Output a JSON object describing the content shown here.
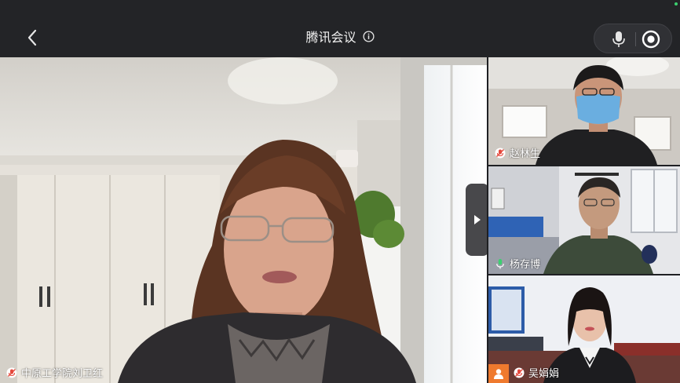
{
  "header": {
    "title": "腾讯会议"
  },
  "participants": {
    "main": {
      "name": "中原工学院刘卫红"
    },
    "tiles": [
      {
        "name": "赵林生"
      },
      {
        "name": "杨存博"
      },
      {
        "name": "吴娟娟"
      }
    ]
  },
  "icons": {
    "back": "chevron-left-icon",
    "info": "info-icon",
    "mic": "microphone-icon",
    "record": "record-icon",
    "expand": "play-arrow-icon",
    "muted": "mic-muted-icon",
    "speaking": "mic-active-icon",
    "avatar": "person-avatar-icon"
  },
  "colors": {
    "topbar": "#232427",
    "muted_red": "#e5483c",
    "speaking_green": "#3cd070",
    "avatar_orange": "#ef7a2e"
  }
}
